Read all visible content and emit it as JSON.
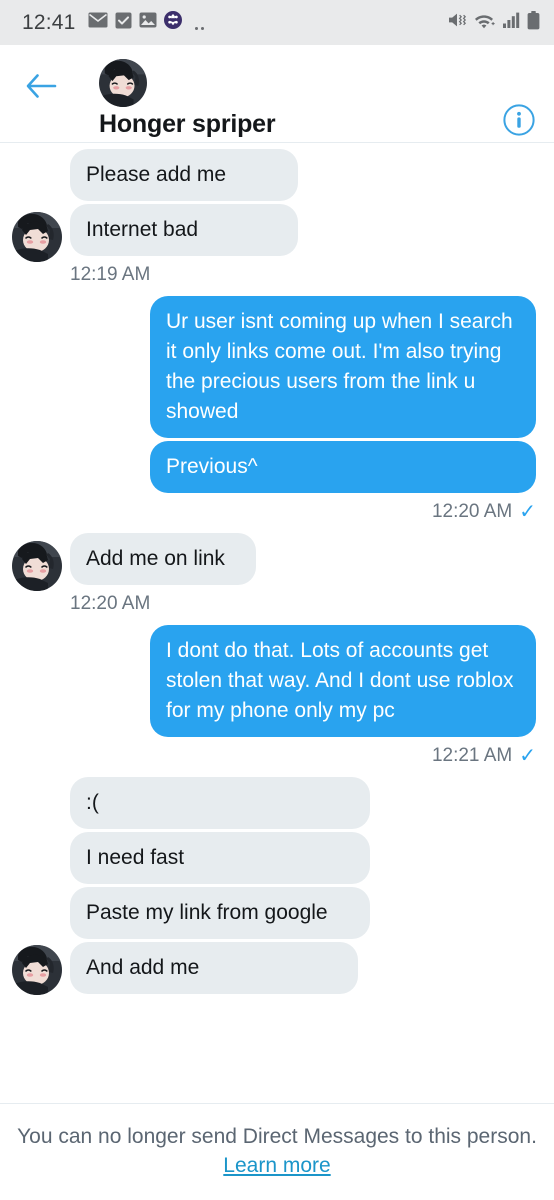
{
  "statusbar": {
    "clock": "12:41",
    "left_icons": [
      "mail-icon",
      "checkbox-icon",
      "image-icon",
      "app-badge-icon",
      "more-dots-icon"
    ],
    "right_icons": [
      "mute-vibrate-icon",
      "wifi-icon",
      "signal-bars-icon",
      "battery-icon"
    ]
  },
  "header": {
    "back_icon": "back-arrow-icon",
    "avatar": "contact-avatar",
    "title": "Honger spriper",
    "info_icon": "info-circle-icon"
  },
  "colors": {
    "outgoing_bubble": "#29a3ef",
    "incoming_bubble": "#e7ecef",
    "accent": "#1b95c9",
    "statusbar_bg": "#e9eaeb"
  },
  "conversation": {
    "groups": [
      {
        "direction": "incoming",
        "messages": [
          "Please add me",
          "Internet bad"
        ],
        "timestamp": "12:19 AM",
        "read_check": ""
      },
      {
        "direction": "outgoing",
        "messages": [
          "Ur user isnt coming up when I search it only links come out. I'm also trying the precious users from the link u showed",
          "Previous^"
        ],
        "timestamp": "12:20 AM",
        "read_check": "✓"
      },
      {
        "direction": "incoming",
        "messages": [
          "Add me on link"
        ],
        "timestamp": "12:20 AM",
        "read_check": ""
      },
      {
        "direction": "outgoing",
        "messages": [
          "I dont do that. Lots of accounts get stolen that way. And I dont use roblox for my phone only my pc"
        ],
        "timestamp": "12:21 AM",
        "read_check": "✓"
      },
      {
        "direction": "incoming",
        "messages": [
          ":(",
          "I need fast",
          "Paste my link from google",
          "And add me"
        ],
        "timestamp": "",
        "read_check": ""
      }
    ]
  },
  "footer": {
    "notice": "You can no longer send Direct Messages to this person.",
    "link": "Learn more"
  }
}
